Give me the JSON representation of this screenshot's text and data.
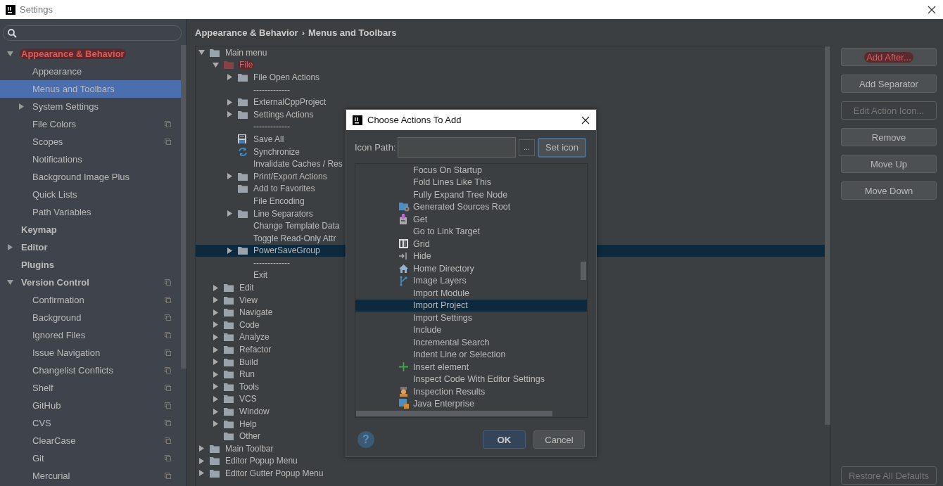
{
  "window": {
    "title": "Settings"
  },
  "sidebar": {
    "items": [
      {
        "label": "Appearance & Behavior",
        "bold": true,
        "expanded": true,
        "highlighted": true,
        "selected": false,
        "children": [
          {
            "label": "Appearance",
            "selected": false
          },
          {
            "label": "Menus and Toolbars",
            "selected": true
          },
          {
            "label": "System Settings",
            "expanded": false,
            "selected": false
          },
          {
            "label": "File Colors",
            "project_level": true,
            "selected": false
          },
          {
            "label": "Scopes",
            "project_level": true,
            "selected": false
          },
          {
            "label": "Notifications",
            "selected": false
          },
          {
            "label": "Background Image Plus",
            "selected": false
          },
          {
            "label": "Quick Lists",
            "selected": false
          },
          {
            "label": "Path Variables",
            "selected": false
          }
        ]
      },
      {
        "label": "Keymap",
        "bold": true,
        "selected": false
      },
      {
        "label": "Editor",
        "bold": true,
        "expanded": false,
        "selected": false
      },
      {
        "label": "Plugins",
        "bold": true,
        "selected": false
      },
      {
        "label": "Version Control",
        "bold": true,
        "expanded": true,
        "project_level": true,
        "selected": false,
        "children": [
          {
            "label": "Confirmation",
            "project_level": true,
            "selected": false
          },
          {
            "label": "Background",
            "project_level": true,
            "selected": false
          },
          {
            "label": "Ignored Files",
            "project_level": true,
            "selected": false
          },
          {
            "label": "Issue Navigation",
            "project_level": true,
            "selected": false
          },
          {
            "label": "Changelist Conflicts",
            "project_level": true,
            "selected": false
          },
          {
            "label": "Shelf",
            "project_level": true,
            "selected": false
          },
          {
            "label": "GitHub",
            "project_level": true,
            "selected": false
          },
          {
            "label": "CVS",
            "project_level": true,
            "selected": false
          },
          {
            "label": "ClearCase",
            "project_level": true,
            "selected": false
          },
          {
            "label": "Git",
            "project_level": true,
            "selected": false
          },
          {
            "label": "Mercurial",
            "project_level": true,
            "selected": false
          }
        ]
      }
    ]
  },
  "breadcrumb": [
    "Appearance & Behavior",
    "›",
    "Menus and Toolbars"
  ],
  "tree": [
    {
      "label": "Main menu",
      "kind": "folder",
      "expanded": true,
      "selected": false,
      "children": [
        {
          "label": "File",
          "kind": "folder",
          "expanded": true,
          "highlighted": true,
          "selected": false,
          "children": [
            {
              "label": "File Open Actions",
              "kind": "folder",
              "expanded": false,
              "selected": false
            },
            {
              "label": "-------------",
              "kind": "separator",
              "selected": false
            },
            {
              "label": "ExternalCppProject",
              "kind": "folder",
              "expanded": false,
              "selected": false
            },
            {
              "label": "Settings Actions",
              "kind": "folder",
              "expanded": false,
              "selected": false
            },
            {
              "label": "-------------",
              "kind": "separator",
              "selected": false
            },
            {
              "label": "Save All",
              "kind": "save",
              "selected": false
            },
            {
              "label": "Synchronize",
              "kind": "sync",
              "selected": false
            },
            {
              "label": "Invalidate Caches / Res",
              "kind": "plain",
              "selected": false
            },
            {
              "label": "Print/Export Actions",
              "kind": "folder",
              "expanded": false,
              "selected": false
            },
            {
              "label": "Add to Favorites",
              "kind": "folder",
              "selected": false
            },
            {
              "label": "File Encoding",
              "kind": "plain",
              "selected": false
            },
            {
              "label": "Line Separators",
              "kind": "folder",
              "expanded": false,
              "selected": false
            },
            {
              "label": "Change Template Data",
              "kind": "plain",
              "selected": false
            },
            {
              "label": "Toggle Read-Only Attr",
              "kind": "plain",
              "selected": false
            },
            {
              "label": "PowerSaveGroup",
              "kind": "folder",
              "expanded": false,
              "selected": true
            },
            {
              "label": "-------------",
              "kind": "separator",
              "selected": false
            },
            {
              "label": "Exit",
              "kind": "plain",
              "selected": false
            }
          ]
        },
        {
          "label": "Edit",
          "kind": "folder",
          "expanded": false,
          "selected": false
        },
        {
          "label": "View",
          "kind": "folder",
          "expanded": false,
          "selected": false
        },
        {
          "label": "Navigate",
          "kind": "folder",
          "expanded": false,
          "selected": false
        },
        {
          "label": "Code",
          "kind": "folder",
          "expanded": false,
          "selected": false
        },
        {
          "label": "Analyze",
          "kind": "folder",
          "expanded": false,
          "selected": false
        },
        {
          "label": "Refactor",
          "kind": "folder",
          "expanded": false,
          "selected": false
        },
        {
          "label": "Build",
          "kind": "folder",
          "expanded": false,
          "selected": false
        },
        {
          "label": "Run",
          "kind": "folder",
          "expanded": false,
          "selected": false
        },
        {
          "label": "Tools",
          "kind": "folder",
          "expanded": false,
          "selected": false
        },
        {
          "label": "VCS",
          "kind": "folder",
          "expanded": false,
          "selected": false
        },
        {
          "label": "Window",
          "kind": "folder",
          "expanded": false,
          "selected": false
        },
        {
          "label": "Help",
          "kind": "folder",
          "expanded": false,
          "selected": false
        },
        {
          "label": "Other",
          "kind": "folder",
          "selected": false
        }
      ]
    },
    {
      "label": "Main Toolbar",
      "kind": "folder",
      "expanded": false,
      "selected": false
    },
    {
      "label": "Editor Popup Menu",
      "kind": "folder",
      "expanded": false,
      "selected": false
    },
    {
      "label": "Editor Gutter Popup Menu",
      "kind": "folder",
      "expanded": false,
      "selected": false
    }
  ],
  "buttons": [
    {
      "label": "Add After...",
      "highlighted": true,
      "disabled": false
    },
    {
      "label": "Add Separator",
      "disabled": false
    },
    {
      "label": "Edit Action Icon...",
      "disabled": true
    },
    {
      "label": "Remove",
      "disabled": false
    },
    {
      "label": "Move Up",
      "disabled": false
    },
    {
      "label": "Move Down",
      "disabled": false
    }
  ],
  "restore_button": {
    "label": "Restore All Defaults",
    "disabled": true
  },
  "dialog": {
    "title": "Choose Actions To Add",
    "icon_path_label": "Icon Path:",
    "browse_button": "...",
    "set_icon_button": "Set icon",
    "actions": [
      {
        "label": "Focus On Startup",
        "kind": "plain",
        "selected": false
      },
      {
        "label": "Fold Lines Like This",
        "kind": "plain",
        "selected": false
      },
      {
        "label": "Fully Expand Tree Node",
        "kind": "plain",
        "selected": false
      },
      {
        "label": "Generated Sources Root",
        "kind": "generated",
        "selected": false
      },
      {
        "label": "Get",
        "kind": "get",
        "selected": false
      },
      {
        "label": "Go to Link Target",
        "kind": "plain",
        "selected": false
      },
      {
        "label": "Grid",
        "kind": "grid",
        "selected": false
      },
      {
        "label": "Hide",
        "kind": "hide",
        "selected": false
      },
      {
        "label": "Home Directory",
        "kind": "home",
        "selected": false
      },
      {
        "label": "Image Layers",
        "kind": "branch",
        "selected": false
      },
      {
        "label": "Import Module",
        "kind": "plain",
        "selected": false
      },
      {
        "label": "Import Project",
        "kind": "plain",
        "selected": true
      },
      {
        "label": "Import Settings",
        "kind": "plain",
        "selected": false
      },
      {
        "label": "Include",
        "kind": "plain",
        "selected": false
      },
      {
        "label": "Incremental Search",
        "kind": "plain",
        "selected": false
      },
      {
        "label": "Indent Line or Selection",
        "kind": "plain",
        "selected": false
      },
      {
        "label": "Insert element",
        "kind": "plus",
        "selected": false
      },
      {
        "label": "Inspect Code With Editor Settings",
        "kind": "plain",
        "selected": false
      },
      {
        "label": "Inspection Results",
        "kind": "inspector",
        "selected": false
      },
      {
        "label": "Java Enterprise",
        "kind": "javaee",
        "selected": false
      }
    ],
    "help_button": "?",
    "ok_button": "OK",
    "cancel_button": "Cancel"
  }
}
